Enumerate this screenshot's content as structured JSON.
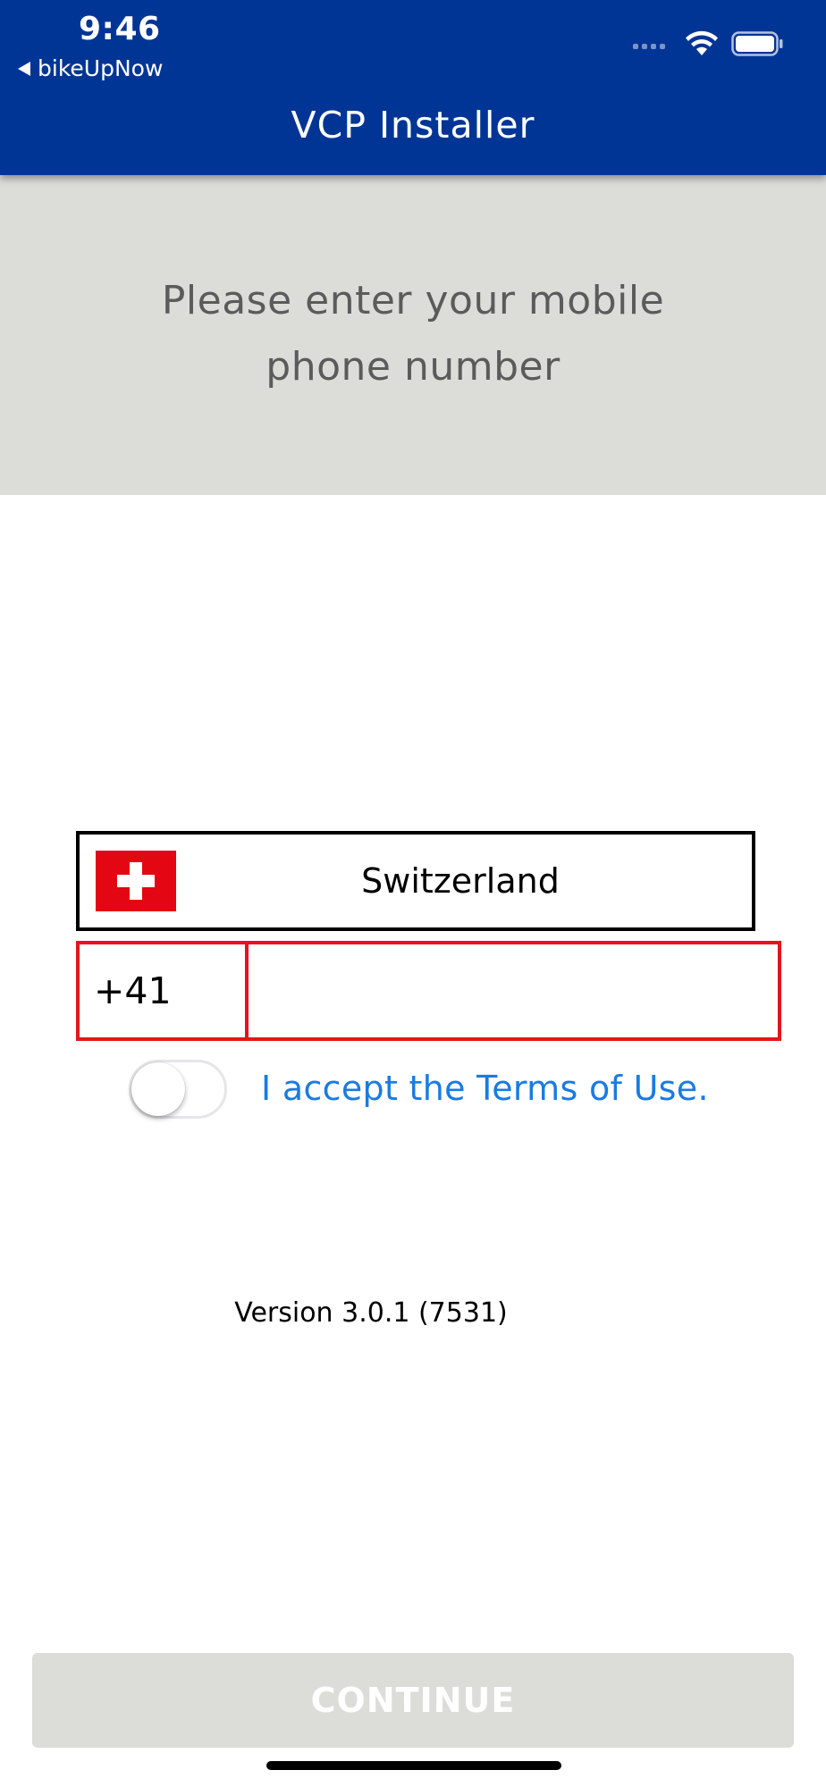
{
  "status_bar": {
    "time": "9:46",
    "back_app": "bikeUpNow",
    "icons": [
      "signal-icon",
      "wifi-icon",
      "battery-icon"
    ]
  },
  "header": {
    "title": "VCP Installer"
  },
  "prompt": {
    "text": "Please enter your mobile phone number"
  },
  "country": {
    "name": "Switzerland",
    "flag_icon": "swiss-flag-icon"
  },
  "phone": {
    "dial_code": "+41",
    "value": ""
  },
  "terms": {
    "accepted": false,
    "label": "I accept the Terms of Use."
  },
  "version": "Version 3.0.1 (7531)",
  "continue_button": {
    "label": "CONTINUE"
  },
  "colors": {
    "header_bg": "#003595",
    "prompt_bg": "#dcdcd9",
    "error_border": "#e2161c",
    "link": "#1a7be0",
    "flag_red": "#e30613"
  }
}
